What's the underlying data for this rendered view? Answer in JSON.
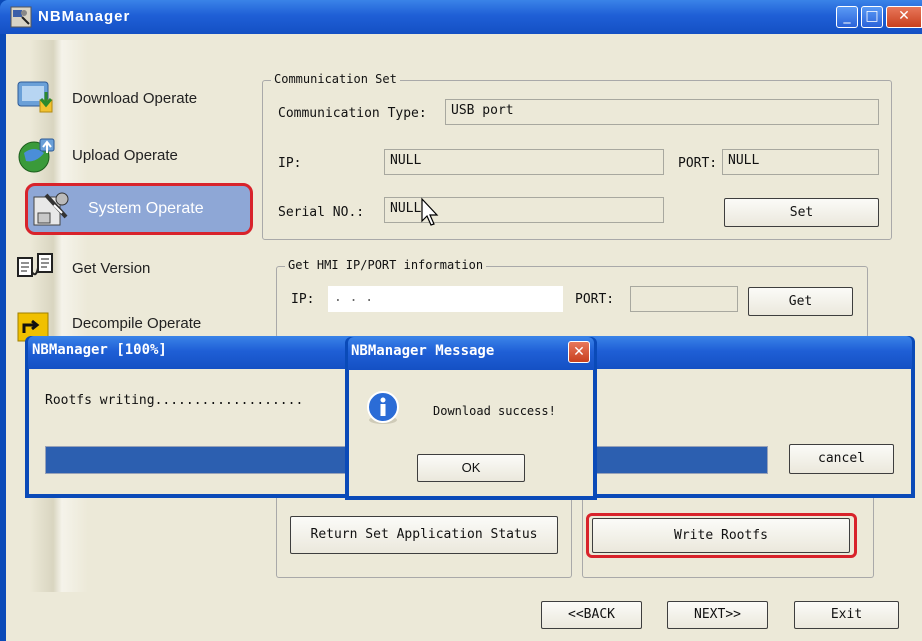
{
  "main_window": {
    "title": "NBManager",
    "min_glyph": "_",
    "max_glyph": "□",
    "close_glyph": "✕"
  },
  "sidebar": {
    "items": [
      {
        "label": "Download Operate"
      },
      {
        "label": "Upload Operate"
      },
      {
        "label": "System Operate"
      },
      {
        "label": "Get Version"
      },
      {
        "label": "Decompile Operate"
      }
    ]
  },
  "communication_set": {
    "group_title": "Communication Set",
    "type_label": "Communication Type:",
    "type_value": "USB port",
    "ip_label": "IP:",
    "ip_value": "NULL",
    "port_label": "PORT:",
    "port_value": "NULL",
    "serial_label": "Serial NO.:",
    "serial_value": "NULL",
    "set_button": "Set"
  },
  "hmi_info": {
    "group_title": "Get HMI IP/PORT information",
    "ip_label": "IP:",
    "ip_value": ".          .          .",
    "port_label": "PORT:",
    "port_value": "",
    "get_button": "Get"
  },
  "system_actions": {
    "return_status_button": "Return Set Application Status",
    "write_rootfs_button": "Write Rootfs"
  },
  "footer": {
    "back_button": "<<BACK",
    "next_button": "NEXT>>",
    "exit_button": "Exit"
  },
  "progress_dialog": {
    "title": "NBManager [100%]",
    "status_text": "Rootfs writing...................",
    "progress": 1.0,
    "cancel_button": "cancel"
  },
  "message_dialog": {
    "title": "NBManager Message",
    "close_glyph": "✕",
    "message": "Download success!",
    "ok_button": "OK",
    "icon": "info-icon"
  },
  "colors": {
    "titlebar": "#1f5fd6",
    "window_bg": "#ece9d8",
    "highlight_red": "#d8232b",
    "selected_item": "#8ea7d6",
    "progress_fill": "#2c5fb0"
  }
}
